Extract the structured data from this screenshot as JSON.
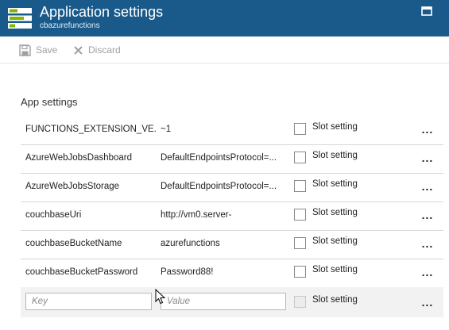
{
  "header": {
    "title": "Application settings",
    "subtitle": "cbazurefunctions",
    "background": "#1a5a8a",
    "app_icon": "app-settings-icon",
    "maximize_icon": "maximize-icon"
  },
  "toolbar": {
    "save_label": "Save",
    "discard_label": "Discard",
    "save_icon": "save-icon",
    "discard_icon": "close-icon",
    "disabled_color": "#a0a0a0"
  },
  "section": {
    "title": "App settings"
  },
  "settings": [
    {
      "key": "FUNCTIONS_EXTENSION_VE...",
      "value": "~1",
      "slot_label": "Slot setting",
      "more": "..."
    },
    {
      "key": "AzureWebJobsDashboard",
      "value": "DefaultEndpointsProtocol=...",
      "slot_label": "Slot setting",
      "more": "..."
    },
    {
      "key": "AzureWebJobsStorage",
      "value": "DefaultEndpointsProtocol=...",
      "slot_label": "Slot setting",
      "more": "..."
    },
    {
      "key": "couchbaseUri",
      "value": "http://vm0.server-",
      "slot_label": "Slot setting",
      "more": "..."
    },
    {
      "key": "couchbaseBucketName",
      "value": "azurefunctions",
      "slot_label": "Slot setting",
      "more": "..."
    },
    {
      "key": "couchbaseBucketPassword",
      "value": "Password88!",
      "slot_label": "Slot setting",
      "more": "..."
    }
  ],
  "new_setting": {
    "key_placeholder": "Key",
    "value_placeholder": "Value",
    "slot_label": "Slot setting",
    "more": "..."
  }
}
